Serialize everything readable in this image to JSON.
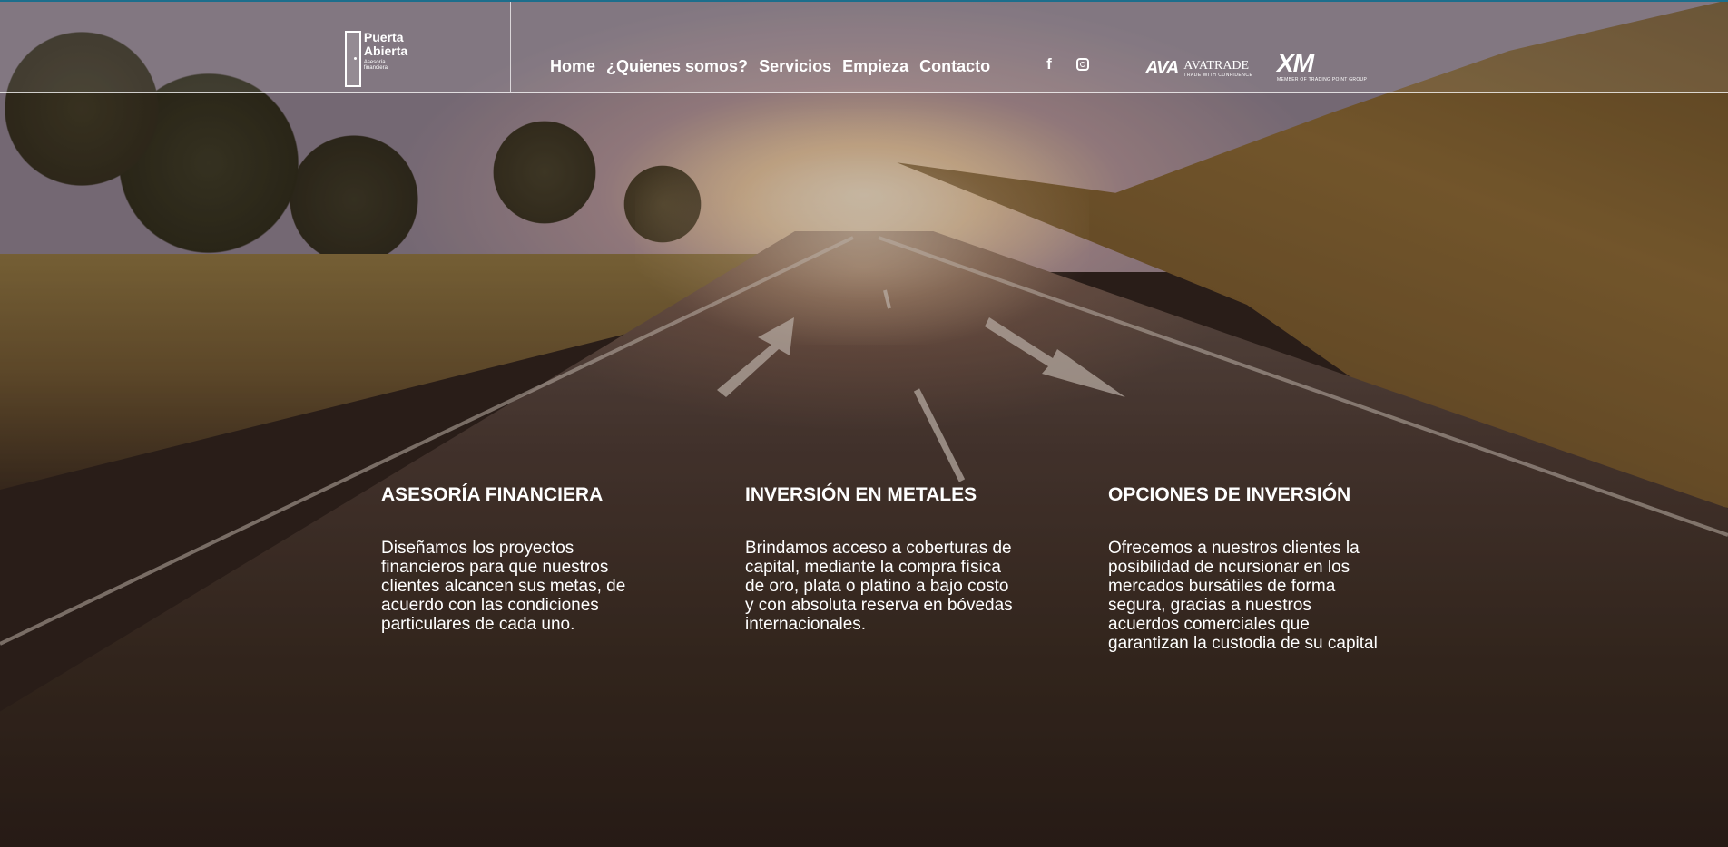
{
  "header": {
    "logo": {
      "line1": "Puerta",
      "line2": "Abierta",
      "line3": "Asesoría financiera"
    },
    "nav": [
      {
        "label": "Home"
      },
      {
        "label": "¿Quienes somos?"
      },
      {
        "label": "Servicios"
      },
      {
        "label": "Empieza"
      },
      {
        "label": "Contacto"
      }
    ],
    "social": [
      {
        "icon": "facebook-icon",
        "glyph": "f"
      },
      {
        "icon": "instagram-icon"
      }
    ],
    "partners": {
      "avatrade": {
        "mark": "AVA",
        "name": "AVATRADE",
        "tagline": "TRADE WITH CONFIDENCE"
      },
      "xm": {
        "mark": "XM",
        "tagline": "MEMBER OF TRADING POINT GROUP"
      }
    }
  },
  "services": [
    {
      "title": "ASESORÍA FINANCIERA",
      "text": "Diseñamos los proyectos financieros para que nuestros clientes alcancen sus metas, de acuerdo con las condiciones particulares de cada uno."
    },
    {
      "title": "INVERSIÓN EN METALES",
      "text": "Brindamos acceso a coberturas de capital, mediante la compra física de oro, plata o platino a bajo costo y con absoluta reserva en bóvedas internacionales."
    },
    {
      "title": "OPCIONES DE INVERSIÓN",
      "text": "Ofrecemos a nuestros clientes la posibilidad de ncursionar en los mercados bursátiles de forma segura, gracias a nuestros acuerdos comerciales que garantizan la custodia de su capital"
    }
  ],
  "colors": {
    "accent": "#1c6e8c",
    "text": "#ffffff"
  }
}
